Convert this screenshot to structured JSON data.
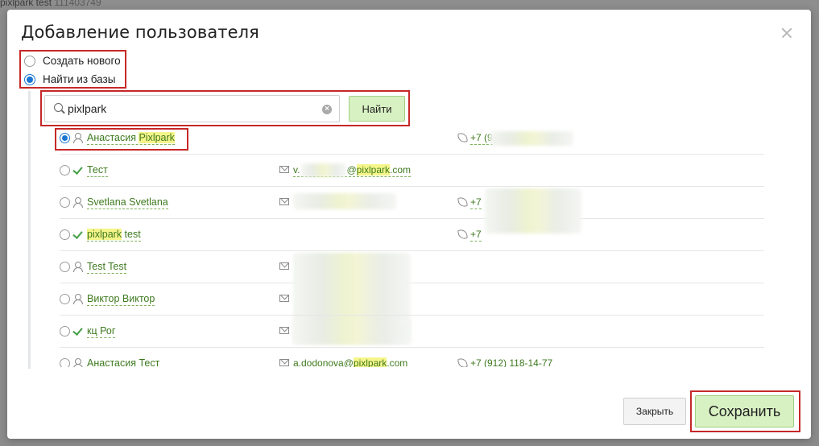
{
  "background": {
    "title": "pixlpark test",
    "id": "111403749"
  },
  "dialog": {
    "title": "Добавление пользователя",
    "mode_options": [
      {
        "label": "Создать нового",
        "checked": false
      },
      {
        "label": "Найти из базы",
        "checked": true
      }
    ],
    "search": {
      "value": "pixlpark",
      "button_label": "Найти"
    },
    "results": [
      {
        "selected": true,
        "status_icon": "user-icon",
        "name_parts": [
          "Анастасия ",
          "Pixlpark"
        ],
        "email_parts": [],
        "phone": "+7 (9"
      },
      {
        "selected": false,
        "status_icon": "check-icon",
        "name_parts": [
          "Тест"
        ],
        "email_parts": [
          "v.",
          "",
          "@",
          "pixlpark",
          ".com"
        ],
        "phone": ""
      },
      {
        "selected": false,
        "status_icon": "user-icon",
        "name_parts": [
          "Svetlana Svetlana"
        ],
        "email_parts": [],
        "phone": "+7"
      },
      {
        "selected": false,
        "status_icon": "check-icon",
        "name_parts": [
          "pixlpark",
          " test"
        ],
        "email_parts": [],
        "phone": "+7"
      },
      {
        "selected": false,
        "status_icon": "user-icon",
        "name_parts": [
          "Test Test"
        ],
        "email_parts": [],
        "phone": ""
      },
      {
        "selected": false,
        "status_icon": "user-icon",
        "name_parts": [
          "Виктор Виктор"
        ],
        "email_parts": [],
        "phone": ""
      },
      {
        "selected": false,
        "status_icon": "check-icon",
        "name_parts": [
          "кц Рог"
        ],
        "email_parts": [],
        "phone": ""
      },
      {
        "selected": false,
        "status_icon": "user-icon",
        "name_parts": [
          "Анастасия Тест"
        ],
        "email_parts": [
          "a.dodonova@",
          "pixlpark",
          ".com"
        ],
        "phone": "+7 (912) 118-14-77"
      }
    ],
    "close_label": "Закрыть",
    "save_label": "Сохранить"
  }
}
